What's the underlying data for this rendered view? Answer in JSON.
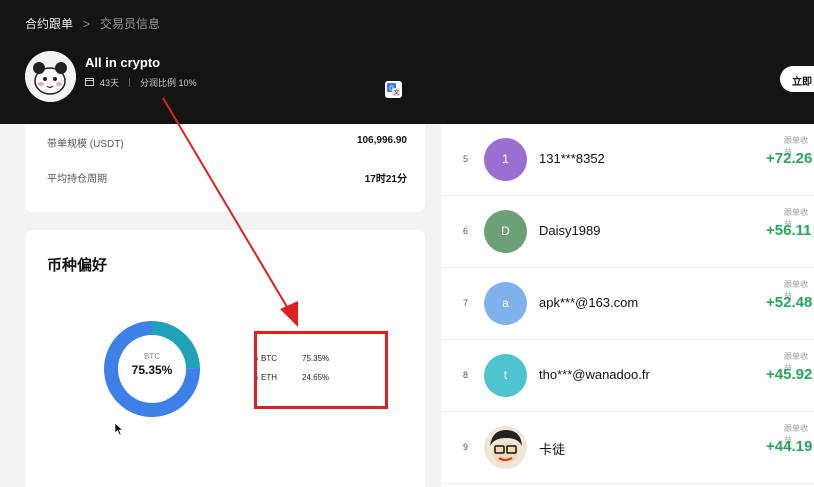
{
  "header": {
    "breadcrumb_root": "合约跟单",
    "breadcrumb_sep": ">",
    "breadcrumb_current": "交易员信息",
    "trader_name": "All in crypto",
    "days": "43天",
    "profit_share": "分润比例  10%",
    "follow_button": "立即"
  },
  "stats": {
    "rows": [
      {
        "label": "带单规模 (USDT)",
        "value": "106,996.90"
      },
      {
        "label": "平均持仓周期",
        "value": "17时21分"
      }
    ]
  },
  "coin_pref": {
    "title": "币种偏好",
    "center_coin": "BTC",
    "center_pct": "75.35%",
    "legend": [
      {
        "name": "BTC",
        "pct": "75.35%",
        "color": "#3f7fe8"
      },
      {
        "name": "ETH",
        "pct": "24.65%",
        "color": "#1fa3b8"
      }
    ]
  },
  "chart_data": {
    "type": "pie",
    "categories": [
      "BTC",
      "ETH"
    ],
    "values": [
      75.35,
      24.65
    ],
    "title": "币种偏好"
  },
  "followers": {
    "profit_label": "跟单收益",
    "rows": [
      {
        "rank": "5",
        "initial": "1",
        "name": "131***8352",
        "profit": "+72.26",
        "color": "#9b6fd0"
      },
      {
        "rank": "6",
        "initial": "D",
        "name": "Daisy1989",
        "profit": "+56.11",
        "color": "#6da077"
      },
      {
        "rank": "7",
        "initial": "a",
        "name": "apk***@163.com",
        "profit": "+52.48",
        "color": "#7fb2ea"
      },
      {
        "rank": "8",
        "initial": "t",
        "name": "tho***@wanadoo.fr",
        "profit": "+45.92",
        "color": "#4fc3cf"
      },
      {
        "rank": "9",
        "initial": "",
        "name": "卡徒",
        "profit": "+44.19",
        "color": "#333333"
      }
    ]
  }
}
